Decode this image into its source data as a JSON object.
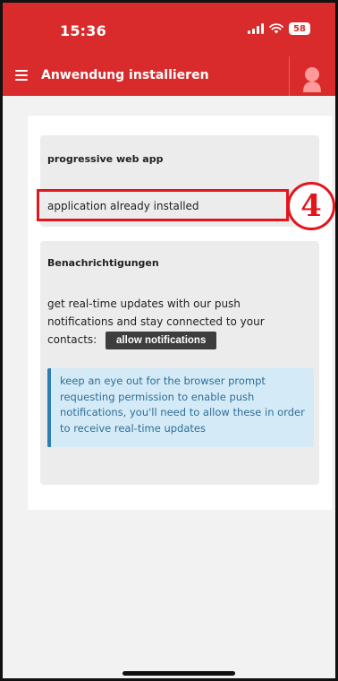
{
  "status": {
    "time": "15:36",
    "battery": "58",
    "icons": [
      "signal-icon",
      "wifi-icon",
      "battery-icon"
    ]
  },
  "appbar": {
    "title": "Anwendung installieren",
    "menu_icon": "menu-icon",
    "avatar_icon": "avatar-icon",
    "color": "#d92b2b"
  },
  "pwa": {
    "title": "progressive web app",
    "status_text": "application already installed"
  },
  "annotation": {
    "step": "4",
    "color": "#e3151c"
  },
  "notifications": {
    "title": "Benachrichtigungen",
    "description": "get real-time updates with our push notifications and stay connected to your contacts:",
    "button_label": "allow notifications",
    "info_text": "keep an eye out for the browser prompt requesting permission to enable push notifications, you'll need to allow these in order to receive real-time updates"
  }
}
